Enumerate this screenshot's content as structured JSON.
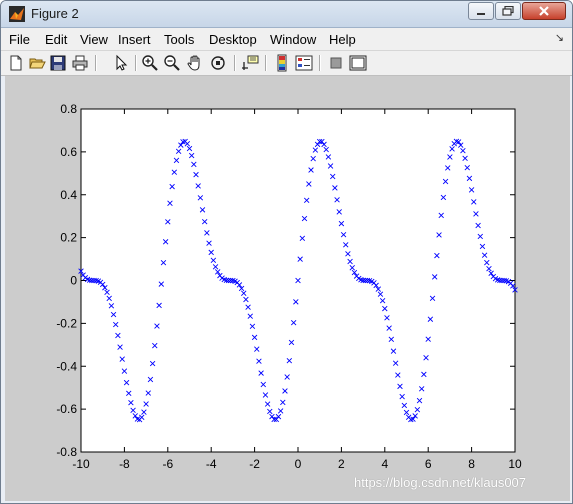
{
  "window": {
    "title": "Figure 2"
  },
  "menu": {
    "items": [
      "File",
      "Edit",
      "View",
      "Insert",
      "Tools",
      "Desktop",
      "Window",
      "Help"
    ]
  },
  "toolbar": {
    "tools": [
      "new-figure-icon",
      "open-file-icon",
      "save-icon",
      "print-icon",
      "edit-plot-arrow-icon",
      "zoom-in-icon",
      "zoom-out-icon",
      "pan-hand-icon",
      "rotate-3d-icon",
      "data-cursor-icon",
      "insert-colorbar-icon",
      "insert-legend-icon",
      "hide-plot-tools-icon",
      "show-plot-tools-icon"
    ]
  },
  "watermark": "https://blog.csdn.net/klaus007",
  "chart_data": {
    "type": "scatter",
    "marker": "x",
    "marker_color": "#0000ff",
    "xlim": [
      -10,
      10
    ],
    "ylim": [
      -0.8,
      0.8
    ],
    "xticks": [
      "-10",
      "-8",
      "-6",
      "-4",
      "-2",
      "0",
      "2",
      "4",
      "6",
      "8",
      "10"
    ],
    "yticks": [
      "0.8",
      "0.6",
      "0.4",
      "0.2",
      "0",
      "-0.2",
      "-0.4",
      "-0.6",
      "-0.8"
    ],
    "series": [
      {
        "x_start": -10,
        "x_end": 10,
        "x_step": 0.1,
        "y_definition": "sin(x)*cos(x/2)^2",
        "y_note": "points sampled every 0.1 from -10 to 10"
      }
    ]
  }
}
